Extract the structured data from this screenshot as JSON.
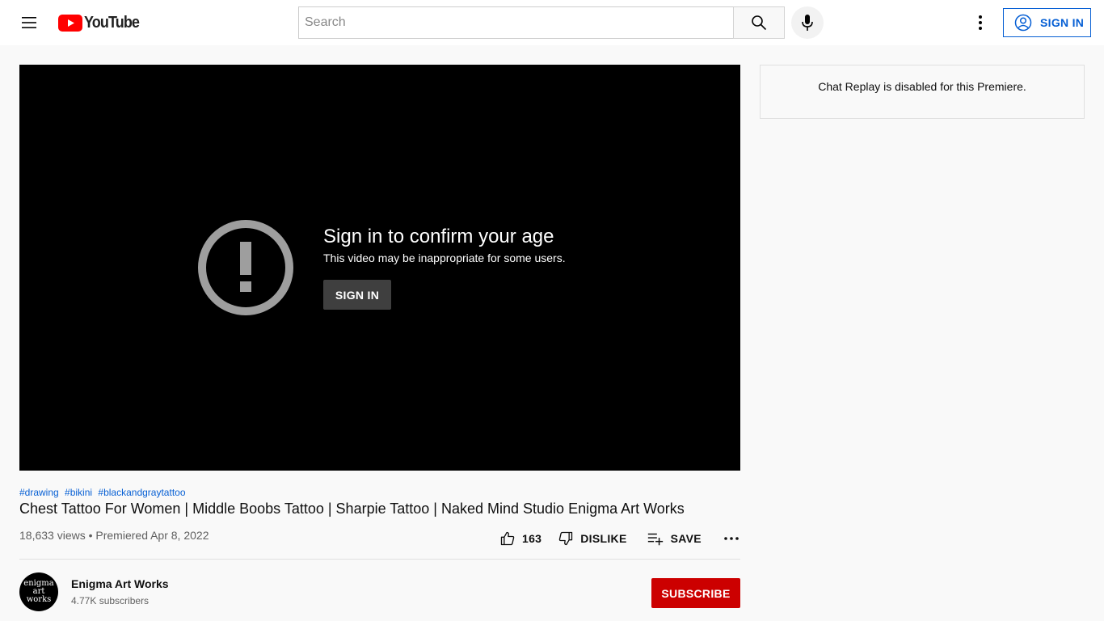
{
  "colors": {
    "accent_blue": "#065fd4",
    "subscribe_red": "#cc0000",
    "logo_red": "#ff0000",
    "player_bg": "#000000",
    "page_bg": "#f9f9f9"
  },
  "masthead": {
    "menu_icon": "hamburger-menu-icon",
    "logo_text": "YouTube",
    "search": {
      "placeholder": "Search",
      "value": ""
    },
    "search_icon": "search-icon",
    "mic_icon": "microphone-icon",
    "more_icon": "vertical-dots-icon",
    "signin_label": "SIGN IN",
    "signin_icon": "account-circle-icon"
  },
  "player": {
    "warning_icon": "exclamation-circle-icon",
    "title": "Sign in to confirm your age",
    "subtitle": "This video may be inappropriate for some users.",
    "signin_label": "SIGN IN"
  },
  "chat": {
    "message": "Chat Replay is disabled for this Premiere."
  },
  "video": {
    "hashtags": [
      "#drawing",
      "#bikini",
      "#blackandgraytattoo"
    ],
    "title": "Chest Tattoo For Women | Middle Boobs Tattoo | Sharpie Tattoo | Naked Mind Studio Enigma Art Works",
    "meta": "18,633 views • Premiered Apr 8, 2022",
    "actions": {
      "like_count": "163",
      "dislike_label": "DISLIKE",
      "save_label": "SAVE"
    }
  },
  "channel": {
    "avatar_lines": [
      "enigma",
      "art",
      "works"
    ],
    "name": "Enigma Art Works",
    "subscribers": "4.77K subscribers",
    "subscribe_label": "SUBSCRIBE"
  }
}
